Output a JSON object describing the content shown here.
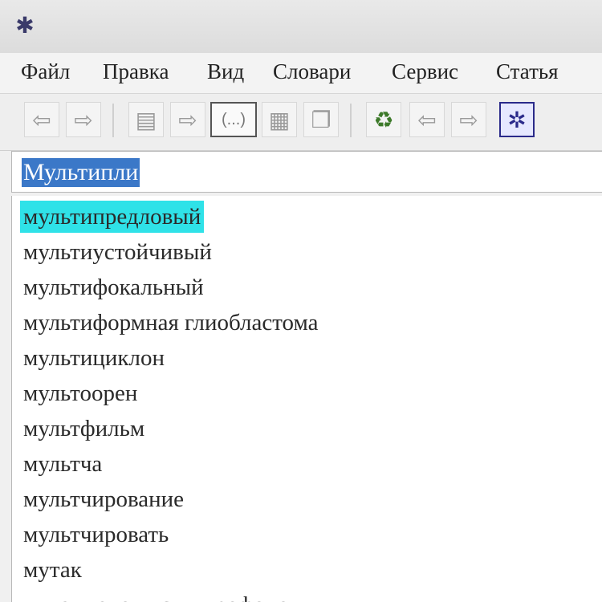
{
  "window": {
    "app_icon": "dictionary-app-icon"
  },
  "menu": [
    {
      "label": "Файл"
    },
    {
      "label": "Правка"
    },
    {
      "label": "Вид"
    },
    {
      "label": "Словари"
    },
    {
      "label": "Сервис"
    },
    {
      "label": "Статья"
    }
  ],
  "toolbar": {
    "buttons": [
      {
        "icon": "back-arrow-icon",
        "glyph": "⇦"
      },
      {
        "icon": "forward-arrow-icon",
        "glyph": "⇨"
      },
      {
        "icon": "print-icon",
        "glyph": "▤"
      },
      {
        "icon": "arrow-icon",
        "glyph": "⇨"
      },
      {
        "icon": "text-frame-icon",
        "glyph": "(...)"
      },
      {
        "icon": "document-icon",
        "glyph": "▦"
      },
      {
        "icon": "copy-icon",
        "glyph": "❐"
      },
      {
        "icon": "recycle-icon",
        "glyph": "♻"
      },
      {
        "icon": "prev-arrow-icon",
        "glyph": "⇦"
      },
      {
        "icon": "next-arrow-icon",
        "glyph": "⇨"
      },
      {
        "icon": "settings-icon",
        "glyph": "✲"
      }
    ]
  },
  "search": {
    "value": "Мультипли"
  },
  "word_list": [
    {
      "text": "мультипредловый",
      "selected": true
    },
    {
      "text": "мультиустойчивый",
      "selected": false
    },
    {
      "text": "мультифокальный",
      "selected": false
    },
    {
      "text": "мультиформная глиобластома",
      "selected": false
    },
    {
      "text": "мультициклон",
      "selected": false
    },
    {
      "text": "мультоорен",
      "selected": false
    },
    {
      "text": "мультфильм",
      "selected": false
    },
    {
      "text": "мультча",
      "selected": false
    },
    {
      "text": "мультчирование",
      "selected": false
    },
    {
      "text": "мультчировать",
      "selected": false
    },
    {
      "text": "мутак",
      "selected": false
    },
    {
      "text": "мутак голови с микрофоном",
      "selected": false
    }
  ],
  "colors": {
    "selection_blue": "#3b78c8",
    "highlight_cyan": "#2fe2e8"
  }
}
